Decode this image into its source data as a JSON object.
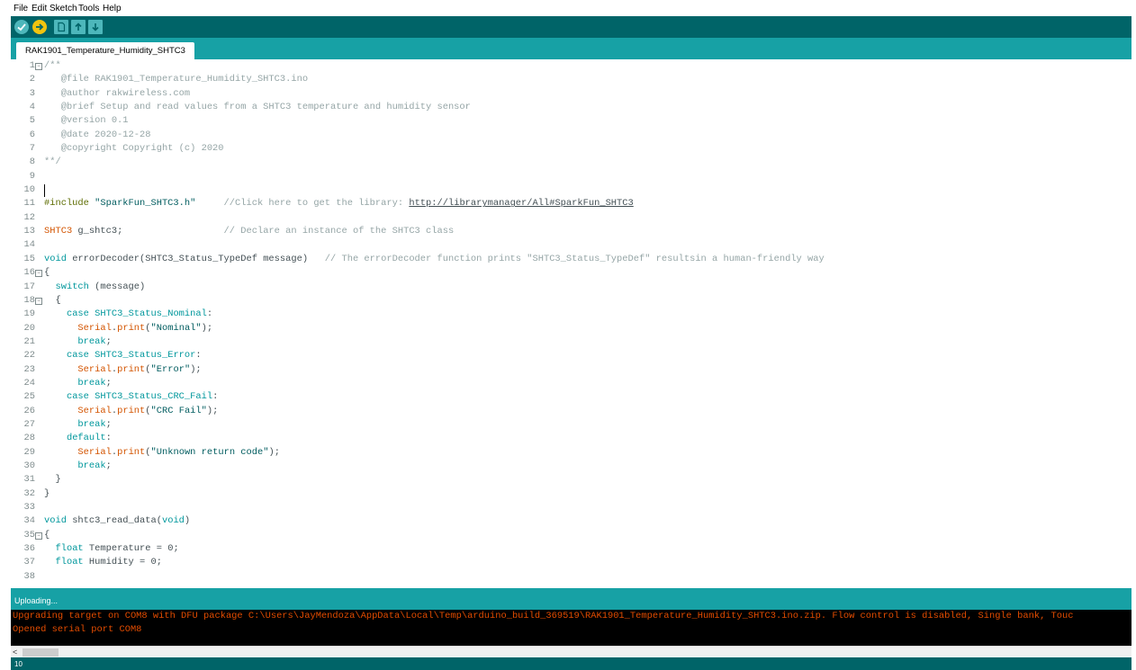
{
  "menu": [
    "File",
    "Edit",
    "Sketch",
    "Tools",
    "Help"
  ],
  "toolbar": {
    "buttons": [
      "verify-icon",
      "upload-icon",
      "new-icon",
      "open-icon",
      "save-icon"
    ],
    "colors": {
      "toolbar_bg": "#006468",
      "round_btn": "#4db7bb",
      "upload_active": "#f1c40f",
      "square_btn": "#4db7bb"
    }
  },
  "tab": {
    "label": "RAK1901_Temperature_Humidity_SHTC3"
  },
  "editor": {
    "lines": [
      {
        "n": "1",
        "fold": true,
        "parts": [
          [
            "c-comment",
            "/**"
          ]
        ]
      },
      {
        "n": "2",
        "fold": false,
        "parts": [
          [
            "c-comment",
            "   @file RAK1901_Temperature_Humidity_SHTC3.ino"
          ]
        ]
      },
      {
        "n": "3",
        "fold": false,
        "parts": [
          [
            "c-comment",
            "   @author rakwireless.com"
          ]
        ]
      },
      {
        "n": "4",
        "fold": false,
        "parts": [
          [
            "c-comment",
            "   @brief Setup and read values from a SHTC3 temperature and humidity sensor"
          ]
        ]
      },
      {
        "n": "5",
        "fold": false,
        "parts": [
          [
            "c-comment",
            "   @version 0.1"
          ]
        ]
      },
      {
        "n": "6",
        "fold": false,
        "parts": [
          [
            "c-comment",
            "   @date 2020-12-28"
          ]
        ]
      },
      {
        "n": "7",
        "fold": false,
        "parts": [
          [
            "c-comment",
            "   @copyright Copyright (c) 2020"
          ]
        ]
      },
      {
        "n": "8",
        "fold": false,
        "parts": [
          [
            "c-comment",
            "**/"
          ]
        ]
      },
      {
        "n": "9",
        "fold": false,
        "parts": []
      },
      {
        "n": "10",
        "fold": false,
        "cursor": true,
        "parts": []
      },
      {
        "n": "11",
        "fold": false,
        "parts": [
          [
            "c-pre",
            "#include "
          ],
          [
            "c-str",
            "\"SparkFun_SHTC3.h\""
          ],
          [
            "c-comment",
            "     //Click here to get the library: "
          ],
          [
            "c-link",
            "http://librarymanager/All#SparkFun_SHTC3"
          ]
        ]
      },
      {
        "n": "12",
        "fold": false,
        "parts": []
      },
      {
        "n": "13",
        "fold": false,
        "parts": [
          [
            "c-type",
            "SHTC3"
          ],
          [
            "c-def",
            " g_shtc3;"
          ],
          [
            "c-comment",
            "                  // Declare an instance of the SHTC3 class"
          ]
        ]
      },
      {
        "n": "14",
        "fold": false,
        "parts": []
      },
      {
        "n": "15",
        "fold": false,
        "parts": [
          [
            "c-kw",
            "void"
          ],
          [
            "c-def",
            " errorDecoder(SHTC3_Status_TypeDef message)"
          ],
          [
            "c-comment",
            "   // The errorDecoder function prints \"SHTC3_Status_TypeDef\" resultsin a human-friendly way"
          ]
        ]
      },
      {
        "n": "16",
        "fold": true,
        "parts": [
          [
            "c-def",
            "{"
          ]
        ]
      },
      {
        "n": "17",
        "fold": false,
        "parts": [
          [
            "c-def",
            "  "
          ],
          [
            "c-kw",
            "switch"
          ],
          [
            "c-def",
            " (message)"
          ]
        ]
      },
      {
        "n": "18",
        "fold": true,
        "parts": [
          [
            "c-def",
            "  {"
          ]
        ]
      },
      {
        "n": "19",
        "fold": false,
        "parts": [
          [
            "c-def",
            "    "
          ],
          [
            "c-kw",
            "case"
          ],
          [
            "c-def",
            " "
          ],
          [
            "c-kw",
            "SHTC3_Status_Nominal"
          ],
          [
            "c-def",
            ":"
          ]
        ]
      },
      {
        "n": "20",
        "fold": false,
        "parts": [
          [
            "c-def",
            "      "
          ],
          [
            "c-type",
            "Serial"
          ],
          [
            "c-def",
            "."
          ],
          [
            "c-type",
            "print"
          ],
          [
            "c-def",
            "("
          ],
          [
            "c-str",
            "\"Nominal\""
          ],
          [
            "c-def",
            ");"
          ]
        ]
      },
      {
        "n": "21",
        "fold": false,
        "parts": [
          [
            "c-def",
            "      "
          ],
          [
            "c-kw",
            "break"
          ],
          [
            "c-def",
            ";"
          ]
        ]
      },
      {
        "n": "22",
        "fold": false,
        "parts": [
          [
            "c-def",
            "    "
          ],
          [
            "c-kw",
            "case"
          ],
          [
            "c-def",
            " "
          ],
          [
            "c-kw",
            "SHTC3_Status_Error"
          ],
          [
            "c-def",
            ":"
          ]
        ]
      },
      {
        "n": "23",
        "fold": false,
        "parts": [
          [
            "c-def",
            "      "
          ],
          [
            "c-type",
            "Serial"
          ],
          [
            "c-def",
            "."
          ],
          [
            "c-type",
            "print"
          ],
          [
            "c-def",
            "("
          ],
          [
            "c-str",
            "\"Error\""
          ],
          [
            "c-def",
            ");"
          ]
        ]
      },
      {
        "n": "24",
        "fold": false,
        "parts": [
          [
            "c-def",
            "      "
          ],
          [
            "c-kw",
            "break"
          ],
          [
            "c-def",
            ";"
          ]
        ]
      },
      {
        "n": "25",
        "fold": false,
        "parts": [
          [
            "c-def",
            "    "
          ],
          [
            "c-kw",
            "case"
          ],
          [
            "c-def",
            " "
          ],
          [
            "c-kw",
            "SHTC3_Status_CRC_Fail"
          ],
          [
            "c-def",
            ":"
          ]
        ]
      },
      {
        "n": "26",
        "fold": false,
        "parts": [
          [
            "c-def",
            "      "
          ],
          [
            "c-type",
            "Serial"
          ],
          [
            "c-def",
            "."
          ],
          [
            "c-type",
            "print"
          ],
          [
            "c-def",
            "("
          ],
          [
            "c-str",
            "\"CRC Fail\""
          ],
          [
            "c-def",
            ");"
          ]
        ]
      },
      {
        "n": "27",
        "fold": false,
        "parts": [
          [
            "c-def",
            "      "
          ],
          [
            "c-kw",
            "break"
          ],
          [
            "c-def",
            ";"
          ]
        ]
      },
      {
        "n": "28",
        "fold": false,
        "parts": [
          [
            "c-def",
            "    "
          ],
          [
            "c-kw",
            "default"
          ],
          [
            "c-def",
            ":"
          ]
        ]
      },
      {
        "n": "29",
        "fold": false,
        "parts": [
          [
            "c-def",
            "      "
          ],
          [
            "c-type",
            "Serial"
          ],
          [
            "c-def",
            "."
          ],
          [
            "c-type",
            "print"
          ],
          [
            "c-def",
            "("
          ],
          [
            "c-str",
            "\"Unknown return code\""
          ],
          [
            "c-def",
            ");"
          ]
        ]
      },
      {
        "n": "30",
        "fold": false,
        "parts": [
          [
            "c-def",
            "      "
          ],
          [
            "c-kw",
            "break"
          ],
          [
            "c-def",
            ";"
          ]
        ]
      },
      {
        "n": "31",
        "fold": false,
        "parts": [
          [
            "c-def",
            "  }"
          ]
        ]
      },
      {
        "n": "32",
        "fold": false,
        "parts": [
          [
            "c-def",
            "}"
          ]
        ]
      },
      {
        "n": "33",
        "fold": false,
        "parts": []
      },
      {
        "n": "34",
        "fold": false,
        "parts": [
          [
            "c-kw",
            "void"
          ],
          [
            "c-def",
            " shtc3_read_data("
          ],
          [
            "c-kw",
            "void"
          ],
          [
            "c-def",
            ")"
          ]
        ]
      },
      {
        "n": "35",
        "fold": true,
        "parts": [
          [
            "c-def",
            "{"
          ]
        ]
      },
      {
        "n": "36",
        "fold": false,
        "parts": [
          [
            "c-def",
            "  "
          ],
          [
            "c-kw",
            "float"
          ],
          [
            "c-def",
            " Temperature = 0;"
          ]
        ]
      },
      {
        "n": "37",
        "fold": false,
        "parts": [
          [
            "c-def",
            "  "
          ],
          [
            "c-kw",
            "float"
          ],
          [
            "c-def",
            " Humidity = 0;"
          ]
        ]
      },
      {
        "n": "38",
        "fold": false,
        "parts": []
      }
    ]
  },
  "status": {
    "text": "Uploading..."
  },
  "console": {
    "lines": [
      "Upgrading target on COM8 with DFU package C:\\Users\\JayMendoza\\AppData\\Local\\Temp\\arduino_build_369519\\RAK1901_Temperature_Humidity_SHTC3.ino.zip. Flow control is disabled, Single bank, Touc",
      "Opened serial port COM8"
    ]
  },
  "scroll": {
    "left_arrow": "<"
  },
  "footer": {
    "line_number": "10"
  }
}
